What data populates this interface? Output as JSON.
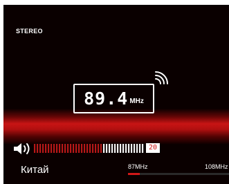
{
  "stereo_label": "STEREO",
  "tuner": {
    "frequency": "89.4",
    "unit": "MHz"
  },
  "volume": {
    "level": 20,
    "max": 32,
    "display": "20"
  },
  "region_label": "Китай",
  "band": {
    "min_label": "87MHz",
    "max_label": "108MHz",
    "min": 87,
    "max": 108,
    "current": 89.4
  },
  "colors": {
    "background": "#0a0000",
    "accent_red": "#c81414",
    "text": "#ffffff"
  },
  "icons": {
    "signal": "signal-icon",
    "volume": "speaker-icon"
  }
}
